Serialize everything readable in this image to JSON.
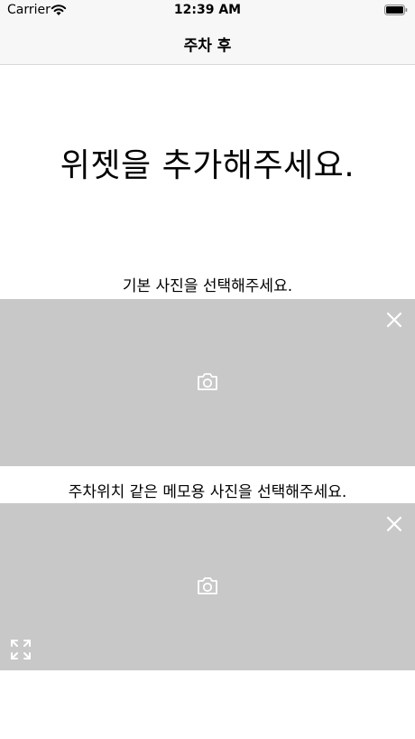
{
  "status_bar": {
    "carrier": "Carrier",
    "time": "12:39 AM",
    "icons": [
      "wifi-icon",
      "battery-icon"
    ]
  },
  "nav": {
    "title": "주차 후"
  },
  "main": {
    "widget_prompt": "위젯을 추가해주세요.",
    "default_photo": {
      "label": "기본 사진을 선택해주세요.",
      "icons": [
        "camera-icon",
        "close-icon"
      ]
    },
    "memo_photo": {
      "label": "주차위치 같은 메모용 사진을 선택해주세요.",
      "icons": [
        "camera-icon",
        "close-icon",
        "expand-icon"
      ]
    }
  },
  "colors": {
    "panel": "#c8c8c8",
    "bar": "#f7f7f7",
    "icon": "#ffffff"
  }
}
